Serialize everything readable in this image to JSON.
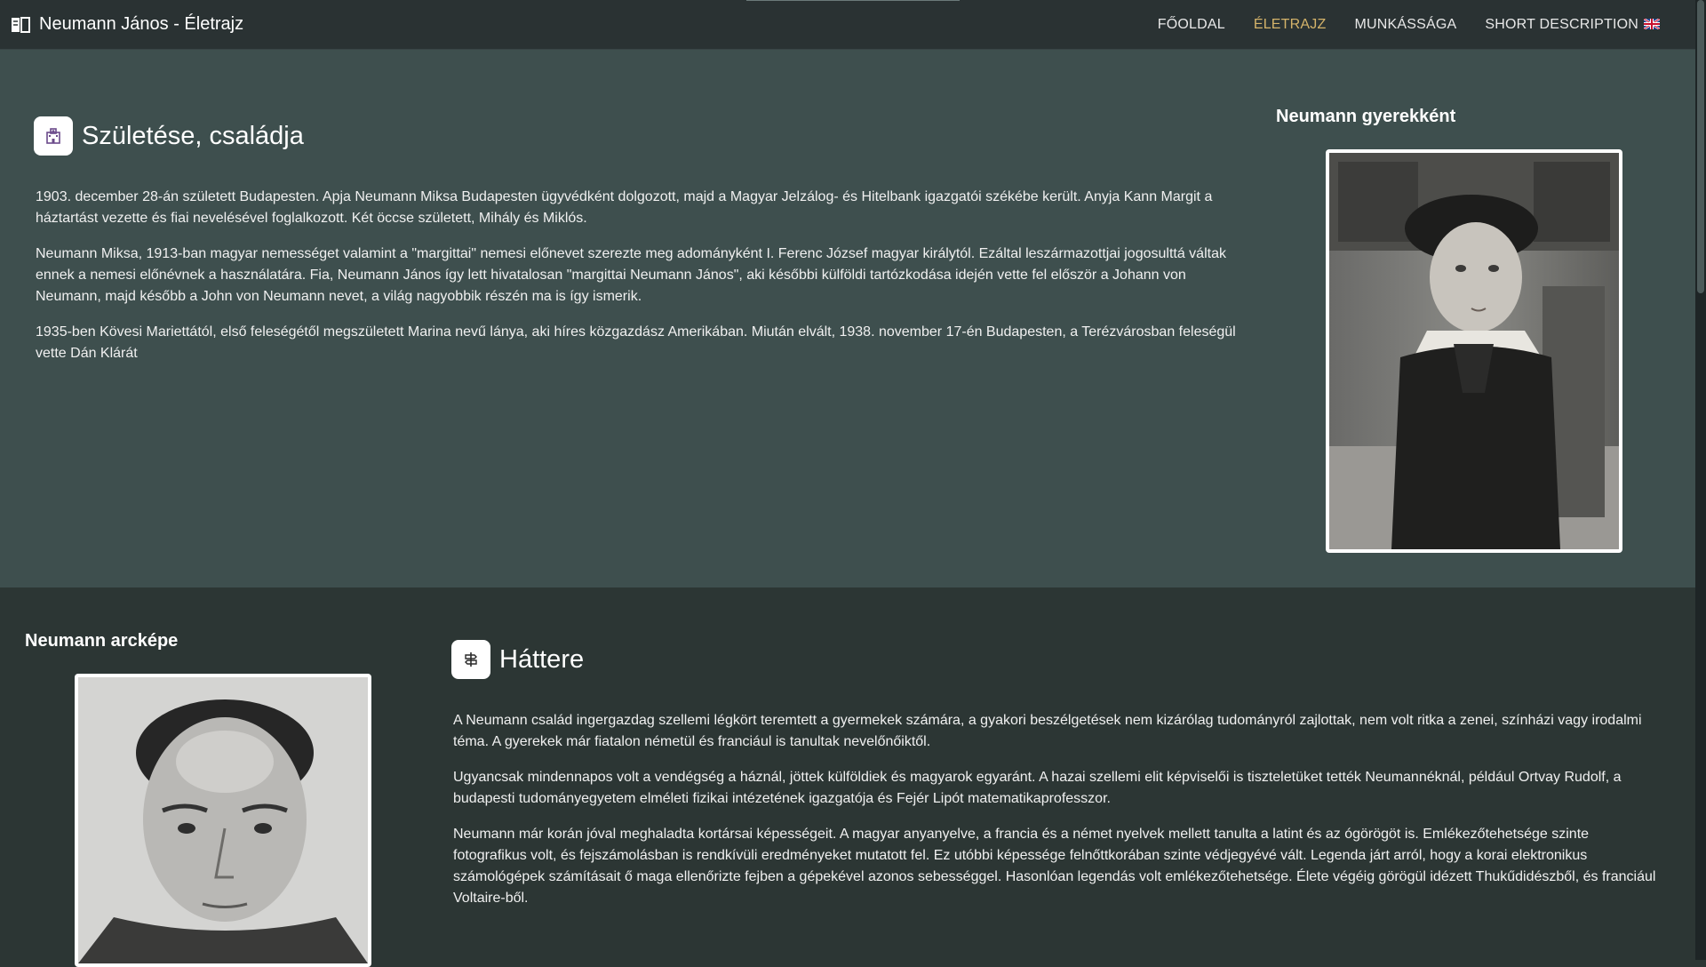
{
  "navbar": {
    "brand_title": "Neumann János - Életrajz",
    "links": [
      {
        "label": "Főoldal",
        "active": false
      },
      {
        "label": "Életrajz",
        "active": true
      },
      {
        "label": "Munkássága",
        "active": false
      },
      {
        "label": "Short description",
        "active": false
      }
    ],
    "active_color": "#d4b36a"
  },
  "birth_section": {
    "heading": "Születése, családja",
    "heading_icon": "hospital-icon",
    "paragraphs": [
      "1903. december 28-án született Budapesten. Apja Neumann Miksa Budapesten ügyvédként dolgozott, majd a Magyar Jelzálog- és Hitelbank igazgatói székébe került. Anyja Kann Margit a háztartást vezette és fiai nevelésével foglalkozott. Két öccse született, Mihály és Miklós.",
      "Neumann Miksa, 1913-ban magyar nemességet valamint a \"margittai\" nemesi előnevet szerezte meg adományként I. Ferenc József magyar királytól. Ezáltal leszármazottjai jogosulttá váltak ennek a nemesi előnévnek a használatára. Fia, Neumann János így lett hivatalosan \"margittai Neumann János\", aki későbbi külföldi tartózkodása idején vette fel először a Johann von Neumann, majd később a John von Neumann nevet, a világ nagyobbik részén ma is így ismerik.",
      "1935-ben Kövesi Mariettától, első feleségétől megszületett Marina nevű lánya, aki híres közgazdász Amerikában. Miután elvált, 1938. november 17-én Budapesten, a Terézvárosban feleségül vette Dán Klárát"
    ],
    "photo_caption": "Neumann gyerekként"
  },
  "background_section": {
    "heading": "Háttere",
    "heading_icon": "signpost-icon",
    "paragraphs": [
      "A Neumann család ingergazdag szellemi légkört teremtett a gyermekek számára, a gyakori beszélgetések nem kizárólag tudományról zajlottak, nem volt ritka a zenei, színházi vagy irodalmi téma. A gyerekek már fiatalon németül és franciául is tanultak nevelőnőiktől.",
      "Ugyancsak mindennapos volt a vendégség a háznál, jöttek külföldiek és magyarok egyaránt. A hazai szellemi elit képviselői is tiszteletüket tették Neumannéknál, például Ortvay Rudolf, a budapesti tudományegyetem elméleti fizikai intézetének igazgatója és Fejér Lipót matematikaprofesszor.",
      "Neumann már korán jóval meghaladta kortársai képességeit. A magyar anyanyelve, a francia és a német nyelvek mellett tanulta a latint és az ógörögöt is. Emlékezőtehetsége szinte fotografikus volt, és fejszámolásban is rendkívüli eredményeket mutatott fel. Ez utóbbi képessége felnőttkorában szinte védjegyévé vált. Legenda járt arról, hogy a korai elektronikus számológépek számításait ő maga ellenőrizte fejben a gépekével azonos sebességgel. Hasonlóan legendás volt emlékezőtehetsége. Élete végéig görögül idézett Thukűdidészből, és franciául Voltaire-ből."
    ],
    "photo_caption": "Neumann arcképe"
  }
}
